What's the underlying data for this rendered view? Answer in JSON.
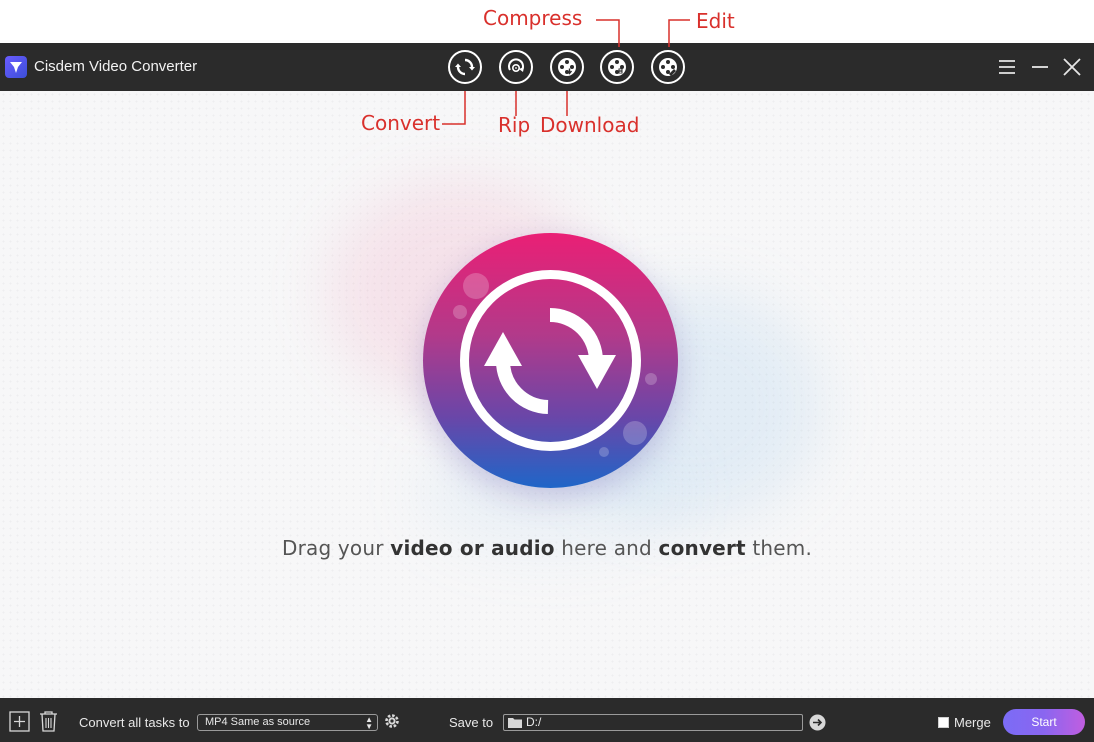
{
  "annotations": {
    "compress": "Compress",
    "edit": "Edit",
    "convert": "Convert",
    "rip": "Rip",
    "download": "Download"
  },
  "app": {
    "title": "Cisdem Video Converter",
    "logo_icon": "cisdem-logo-icon"
  },
  "toolbar": {
    "modes": [
      {
        "name": "convert",
        "icon": "convert-mode-icon"
      },
      {
        "name": "rip",
        "icon": "rip-mode-icon"
      },
      {
        "name": "download",
        "icon": "download-mode-icon"
      },
      {
        "name": "compress",
        "icon": "compress-mode-icon"
      },
      {
        "name": "edit",
        "icon": "edit-mode-icon"
      }
    ],
    "window_controls": [
      "menu-icon",
      "minimize-icon",
      "close-icon"
    ]
  },
  "main": {
    "drop_text": {
      "part1": "Drag your ",
      "bold1": "video or audio",
      "part2": " here and ",
      "bold2": "convert",
      "part3": " them."
    }
  },
  "bottom": {
    "convert_all_label": "Convert all tasks to",
    "format_value": "MP4 Same as source",
    "save_to_label": "Save to",
    "save_path": "D:/",
    "merge_label": "Merge",
    "merge_checked": false,
    "start_label": "Start"
  },
  "colors": {
    "annotation": "#d9302c",
    "titlebar": "#2b2b2b",
    "accent_pink": "#ea1f75",
    "accent_blue": "#1f66c8",
    "start_button": "#8a66f0"
  }
}
